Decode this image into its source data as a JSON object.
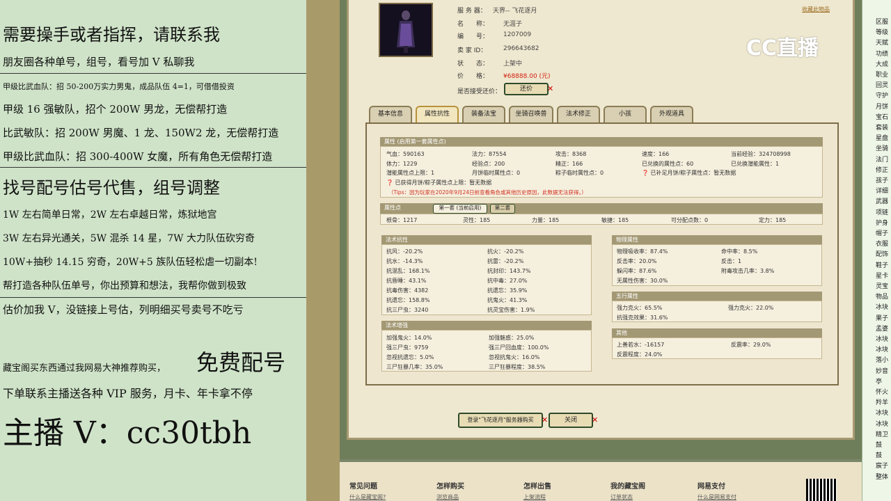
{
  "left_panel": {
    "lines": [
      "需要操手或者指挥，请联系我",
      "朋友圈各种单号，组号，看号加 V 私聊我",
      "甲级比武血队：招 50-200万实力男鬼，成品队伍 4=1，可借借投资",
      "甲级 16 强敏队，招个 200W 男龙，无偿帮打造",
      "比武敏队：招 200W 男魔、1 龙、150W2 龙，无偿帮打造",
      "甲级比武血队：招 300-400W 女魔，所有角色无偿帮打造",
      "找号配号估号代售，组号调整",
      "1W 左右简单日常，2W 左右卓越日常，炼狱地宫",
      "3W 左右异光通关，5W 混杀 14 星，7W 大力队伍砍穷奇",
      "10W+抽秒 14.15 穷奇，20W+5 族队伍轻松虐一切副本!",
      "帮打造各种队伍单号，你出预算和想法，我帮你做到极致",
      "估价加我 V，没链接上号估，列明细买号卖号不吃亏",
      "藏宝阁买东西通过我网易大神推荐购买，",
      "免费配号",
      "下单联系主播送各种 VIP 服务，月卡、年卡拿不停",
      "主播 V：cc30tbh"
    ]
  },
  "watermark": "CC直播",
  "fav_link": "收藏此物品",
  "info": {
    "server_label": "服 务 器：",
    "server_value": "天界-- 飞花逐月",
    "name_label": "名　　称：",
    "name_value": "无涯子",
    "id_label": "编　　号：",
    "id_value": "1207009",
    "seller_label": "卖 家 ID：",
    "seller_value": "296643682",
    "status_label": "状　　态：",
    "status_value": "上架中",
    "price_label": "价　　格：",
    "price_value": "¥68888.00 (元)",
    "bargain_label": "是否接受还价：",
    "bargain_button": "还价"
  },
  "tabs": [
    "基本信息",
    "属性抗性",
    "装备法宝",
    "坐骑召唤兽",
    "法术修正",
    "小孩",
    "外观道具"
  ],
  "attr": {
    "head": "属性 (启用第一套属性点)",
    "cells": [
      "气血：590163",
      "法力：87554",
      "攻击：8368",
      "速度：166",
      "当前经验：324708998",
      "体力：1229",
      "经验点：200",
      "精正：166",
      "已兑换的属性点：60",
      "已兑换潜能属性：1",
      "潜能属性点上限：1",
      "月饼临时属性点：0",
      "粽子临时属性点：0",
      "已补足月饼/粽子属性点：暂无数据"
    ],
    "note": "已获得月饼/粽子属性点上限：暂无数据",
    "tip": "（Tips：因为玩家在2020年9月24日前查看角色或其他历史原因，此数据无法获得。）"
  },
  "points": {
    "head": "属性点",
    "tab1": "第一套 (当前启用)",
    "tab2": "第二套",
    "cells": [
      "根骨：1217",
      "灵性：185",
      "力量：185",
      "敏捷：185",
      "可分配点数：0",
      "定力：185"
    ]
  },
  "resist": {
    "head": "法术抗性",
    "cells": [
      "抗风：-20.2%",
      "抗火：-20.2%",
      "抗水：-14.3%",
      "抗雷：-20.2%",
      "抗混乱：168.1%",
      "抗封印：143.7%",
      "抗昏睡：43.1%",
      "抗中毒：27.0%",
      "抗毒伤害：4382",
      "抗遗忘：35.9%",
      "抗遗忘：158.8%",
      "抗鬼火：41.3%",
      "抗三尸虫：3240",
      "抗灵宝伤害：1.9%"
    ]
  },
  "boost": {
    "head": "法术增强",
    "cells": [
      "加强鬼火：14.0%",
      "加强魅惑：25.0%",
      "强三尸虫：9759",
      "强三尸回血度：100.0%",
      "忽视抗遗忘：5.0%",
      "忽视抗鬼火：16.0%",
      "三尸狂暴几率：35.0%",
      "三尸狂暴程度：38.5%"
    ]
  },
  "physical": {
    "head": "物理属性",
    "cells": [
      "物理吸收率：87.4%",
      "命中率：8.5%",
      "反击率：20.0%",
      "反击：1",
      "躲闪率：87.6%",
      "附毒攻击几率：3.8%",
      "无属性伤害：30.0%"
    ]
  },
  "five": {
    "head": "五行属性",
    "cells": [
      "强力克火：65.5%",
      "强力克火：22.0%",
      "抗强克效果：31.6%"
    ]
  },
  "other": {
    "head": "其他",
    "cells": [
      "上善若水：-16157",
      "反震率：29.0%",
      "反震程度：24.0%"
    ]
  },
  "buy_button": "登录\"飞花逐月\"服务器购买",
  "close_button": "关闭",
  "footer": {
    "cols": [
      {
        "head": "常见问题",
        "link": "什么是藏宝阁?"
      },
      {
        "head": "怎样购买",
        "link": "浏览商品"
      },
      {
        "head": "怎样出售",
        "link": "上架流程"
      },
      {
        "head": "我的藏宝阁",
        "link": "订单状态"
      },
      {
        "head": "网易支付",
        "link": "什么是网易支付"
      }
    ]
  },
  "right_strip": {
    "items": [
      "区服",
      "等级",
      "天赋",
      "功绩",
      "大成",
      "职业",
      "回灵",
      "守护",
      "月饼",
      "宝石",
      "套装",
      "星盘",
      "坐骑",
      "法门",
      "修正",
      "孩子",
      "详细",
      "武器",
      "项链",
      "护身",
      "帽子",
      "衣服",
      "配饰",
      "鞋子",
      "星卡",
      "灵宝",
      "物品",
      "冰块",
      "果子",
      "孟婆",
      "冰块",
      "冰块",
      "落小",
      "妙音",
      "亭",
      "怀火",
      "羚羊",
      "冰块",
      "冰块",
      "精卫",
      "鼓",
      "鼓",
      "宸子",
      "整体"
    ]
  }
}
